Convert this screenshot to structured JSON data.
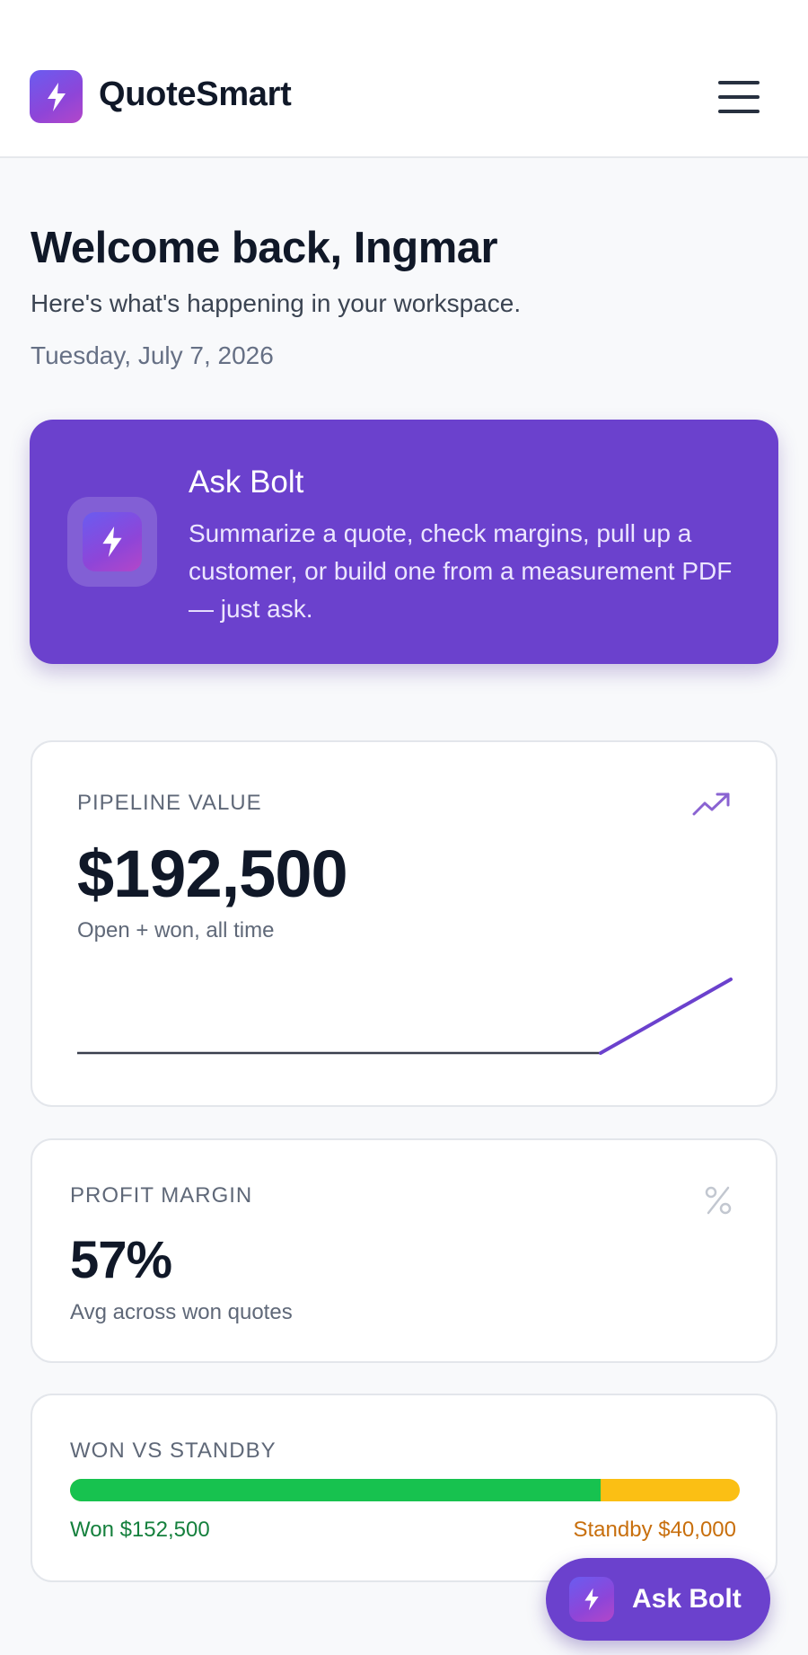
{
  "header": {
    "brand": "QuoteSmart",
    "logo_icon": "bolt-icon",
    "menu_icon": "hamburger-menu-icon"
  },
  "welcome": {
    "title": "Welcome back, Ingmar",
    "subtitle": "Here's what's happening in your workspace.",
    "date": "Tuesday, July 7, 2026"
  },
  "ask_bolt_card": {
    "title": "Ask Bolt",
    "description": "Summarize a quote, check margins, pull up a customer, or build one from a measurement PDF — just ask.",
    "icon": "bolt-icon"
  },
  "pipeline": {
    "label": "PIPELINE VALUE",
    "value": "$192,500",
    "note": "Open + won, all time",
    "icon": "trend-up-icon"
  },
  "profit_margin": {
    "label": "PROFIT MARGIN",
    "value": "57%",
    "note": "Avg across won quotes",
    "icon": "percent-icon"
  },
  "won_vs_standby": {
    "label": "WON VS STANDBY",
    "won_text": "Won $152,500",
    "standby_text": "Standby $40,000",
    "won_amount": 152500,
    "standby_amount": 40000
  },
  "fab": {
    "label": "Ask Bolt",
    "icon": "bolt-icon"
  },
  "colors": {
    "accent": "#6b41cd",
    "won": "#17c24f",
    "standby": "#fbbf14",
    "text": "#101828",
    "muted": "#5f6878"
  }
}
